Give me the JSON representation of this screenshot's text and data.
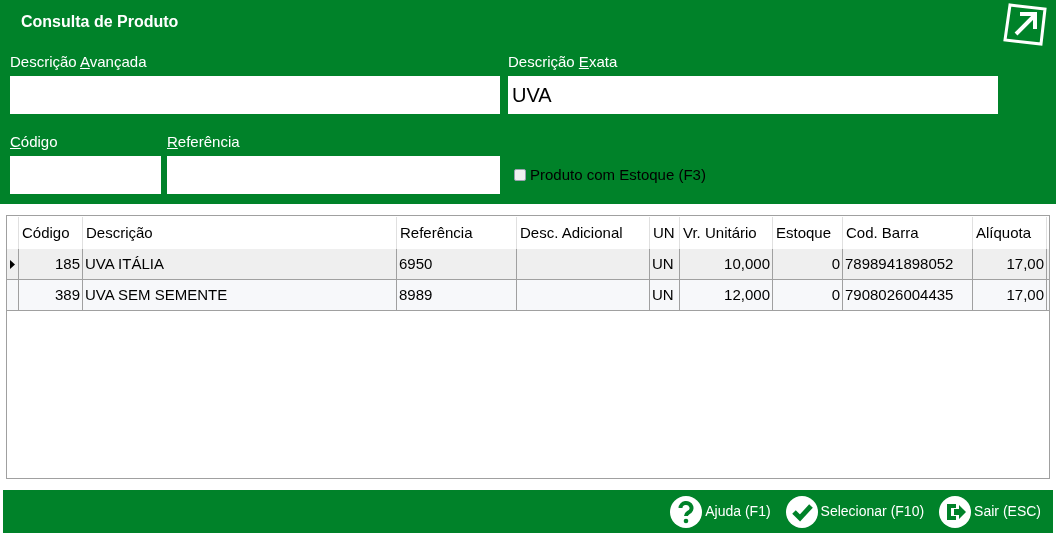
{
  "window": {
    "title": "Consulta de Produto"
  },
  "fields": [
    {
      "label": {
        "before": "Descrição ",
        "key": "A",
        "after": "vançada"
      }
    },
    {
      "label": {
        "before": "Descrição ",
        "key": "E",
        "after": "xata"
      },
      "value": "UVA"
    },
    {
      "label": {
        "key": "C",
        "after": "ódigo"
      }
    },
    {
      "label": {
        "key": "R",
        "after": "eferência"
      }
    }
  ],
  "stock_filter": {
    "label": "Produto com Estoque (F3)",
    "checked": false
  },
  "table": {
    "columns": [
      "Código",
      "Descrição",
      "Referência",
      "Desc. Adicional",
      "UN",
      "Vr. Unitário",
      "Estoque",
      "Cod. Barra",
      "Alíquota"
    ],
    "rows": [
      {
        "selected": true,
        "cells": [
          "185",
          "UVA ITÁLIA",
          "6950",
          "",
          "UN",
          "10,000",
          "0",
          "7898941898052",
          "17,00"
        ]
      },
      {
        "selected": false,
        "cells": [
          "389",
          "UVA SEM SEMENTE",
          "8989",
          "",
          "UN",
          "12,000",
          "0",
          "7908026004435",
          "17,00"
        ]
      }
    ]
  },
  "footer": {
    "buttons": [
      {
        "kind": "help",
        "label": "Ajuda (F1)"
      },
      {
        "kind": "select",
        "label": "Selecionar (F10)"
      },
      {
        "kind": "exit",
        "label": "Sair (ESC)"
      }
    ]
  }
}
